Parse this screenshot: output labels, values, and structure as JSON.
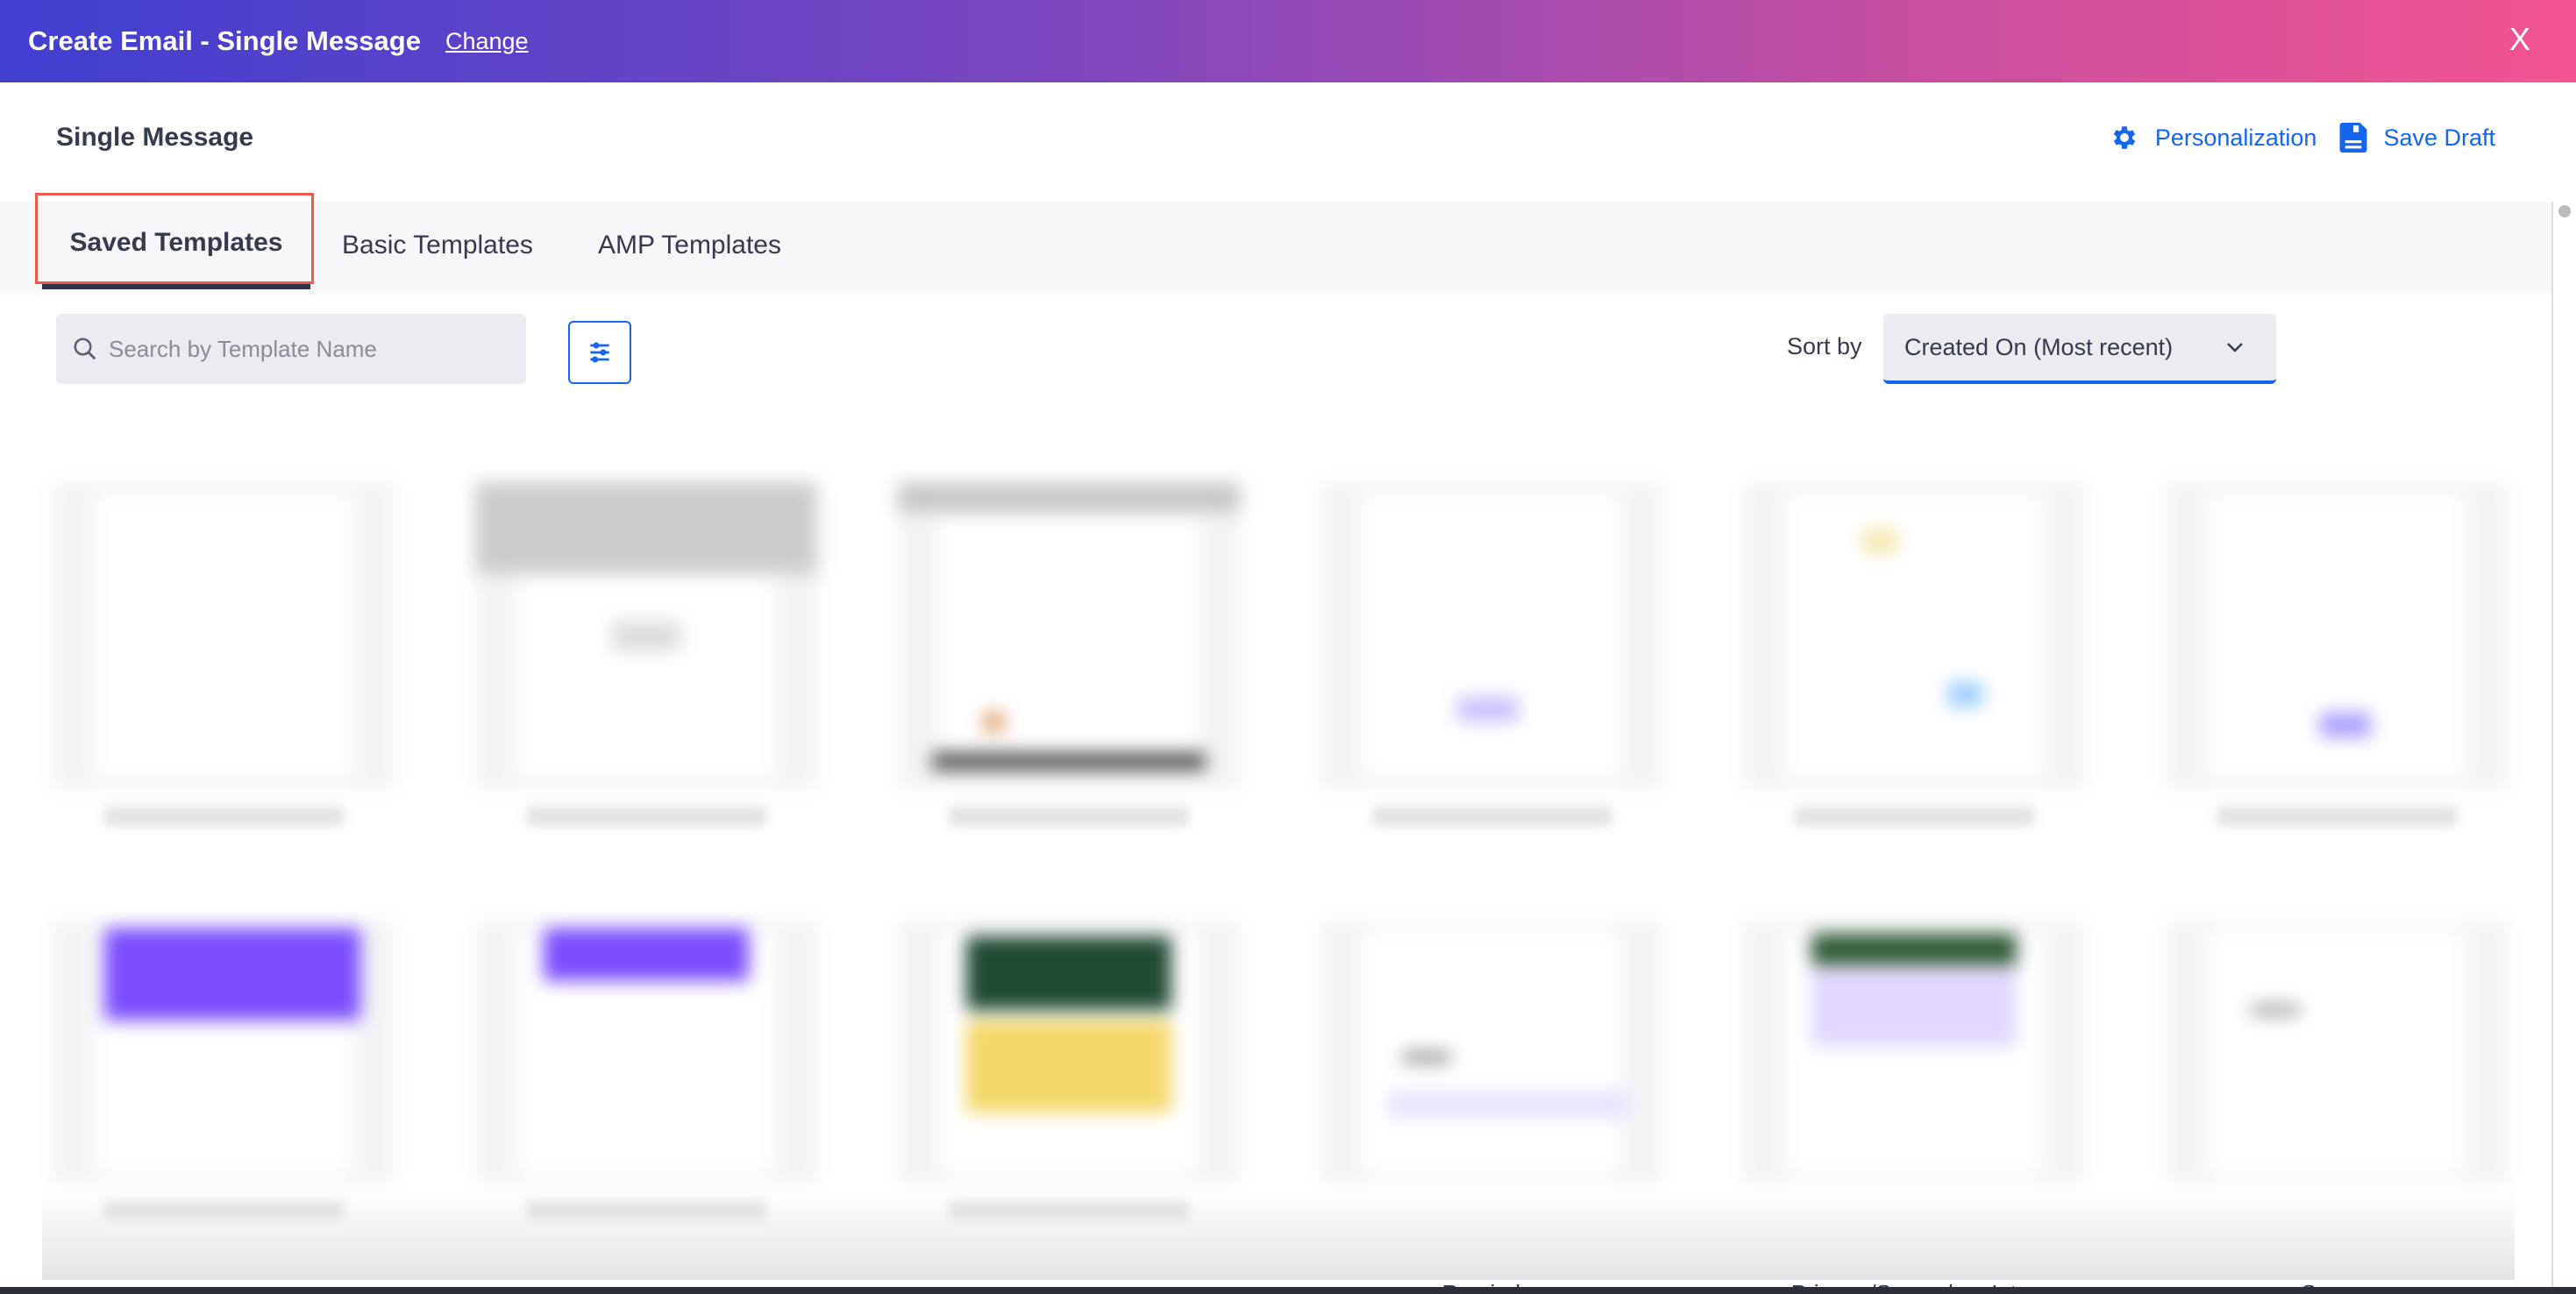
{
  "header": {
    "title": "Create Email - Single Message",
    "change_label": "Change",
    "close_label": "X"
  },
  "subheader": {
    "name": "Single Message",
    "personalization_label": "Personalization",
    "save_draft_label": "Save Draft"
  },
  "tabs": [
    {
      "label": "Saved Templates",
      "active": true
    },
    {
      "label": "Basic Templates",
      "active": false
    },
    {
      "label": "AMP Templates",
      "active": false
    }
  ],
  "toolbar": {
    "search_placeholder": "Search by Template Name",
    "search_value": "",
    "sort_label": "Sort by",
    "sort_value": "Created On (Most recent)"
  },
  "cards_row2_labels": [
    "",
    "",
    "",
    "Reminder",
    "Primary/Secondary Intro",
    "Survey"
  ],
  "colors": {
    "accent": "#1465f2",
    "highlight": "#ee5a4e",
    "gradient_start": "#3f3fd0",
    "gradient_end": "#f25390"
  }
}
